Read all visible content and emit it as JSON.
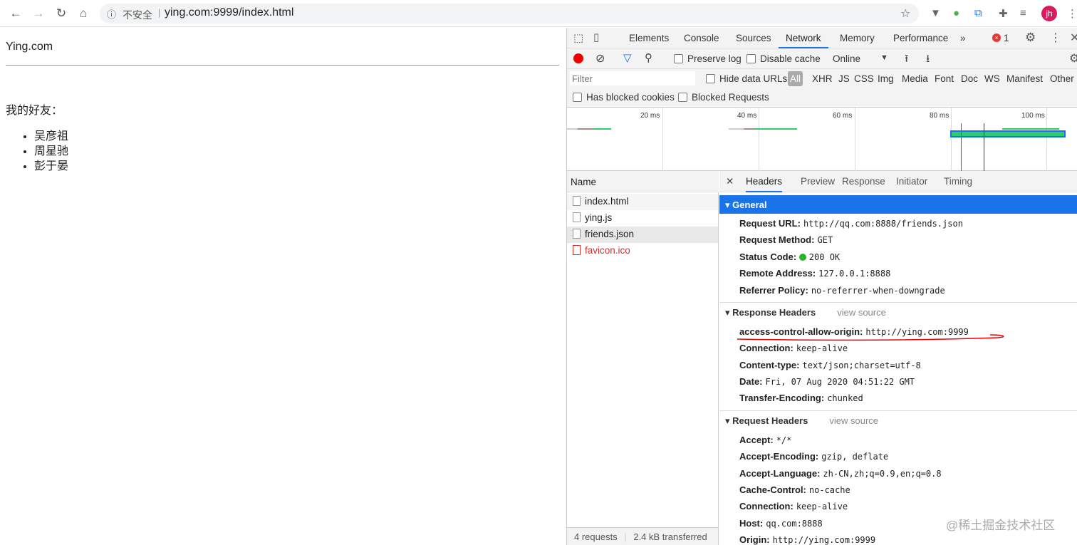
{
  "browser": {
    "insecure_label": "不安全",
    "url": "ying.com:9999/index.html",
    "avatar": "jh"
  },
  "page": {
    "title": "Ying.com",
    "friends_label": "我的好友：",
    "friends": [
      "吴彦祖",
      "周星驰",
      "彭于晏"
    ]
  },
  "devtools": {
    "tabs": [
      "Elements",
      "Console",
      "Sources",
      "Network",
      "Memory",
      "Performance"
    ],
    "active_tab": "Network",
    "more": "»",
    "error_count": "1",
    "toolbar": {
      "preserve_log": "Preserve log",
      "disable_cache": "Disable cache",
      "throttle": "Online"
    },
    "filter": {
      "placeholder": "Filter",
      "hide_data_urls": "Hide data URLs",
      "types": [
        "All",
        "XHR",
        "JS",
        "CSS",
        "Img",
        "Media",
        "Font",
        "Doc",
        "WS",
        "Manifest",
        "Other"
      ],
      "has_blocked_cookies": "Has blocked cookies",
      "blocked_requests": "Blocked Requests"
    },
    "timeline_ticks": [
      "20 ms",
      "40 ms",
      "60 ms",
      "80 ms",
      "100 ms"
    ],
    "name_header": "Name",
    "files": [
      {
        "name": "index.html",
        "error": false
      },
      {
        "name": "ying.js",
        "error": false
      },
      {
        "name": "friends.json",
        "error": false,
        "selected": true
      },
      {
        "name": "favicon.ico",
        "error": true
      }
    ],
    "status": {
      "requests": "4 requests",
      "transferred": "2.4 kB transferred"
    },
    "detail_tabs": [
      "Headers",
      "Preview",
      "Response",
      "Initiator",
      "Timing"
    ],
    "general": {
      "title": "General",
      "rows": [
        [
          "Request URL:",
          "http://qq.com:8888/friends.json"
        ],
        [
          "Request Method:",
          "GET"
        ],
        [
          "Status Code:",
          "200 OK"
        ],
        [
          "Remote Address:",
          "127.0.0.1:8888"
        ],
        [
          "Referrer Policy:",
          "no-referrer-when-downgrade"
        ]
      ]
    },
    "response_headers": {
      "title": "Response Headers",
      "view_source": "view source",
      "rows": [
        [
          "access-control-allow-origin:",
          "http://ying.com:9999"
        ],
        [
          "Connection:",
          "keep-alive"
        ],
        [
          "Content-type:",
          "text/json;charset=utf-8"
        ],
        [
          "Date:",
          "Fri, 07 Aug 2020 04:51:22 GMT"
        ],
        [
          "Transfer-Encoding:",
          "chunked"
        ]
      ]
    },
    "request_headers": {
      "title": "Request Headers",
      "view_source": "view source",
      "rows": [
        [
          "Accept:",
          "*/*"
        ],
        [
          "Accept-Encoding:",
          "gzip, deflate"
        ],
        [
          "Accept-Language:",
          "zh-CN,zh;q=0.9,en;q=0.8"
        ],
        [
          "Cache-Control:",
          "no-cache"
        ],
        [
          "Connection:",
          "keep-alive"
        ],
        [
          "Host:",
          "qq.com:8888"
        ],
        [
          "Origin:",
          "http://ying.com:9999"
        ]
      ]
    }
  },
  "watermark": "@稀土掘金技术社区"
}
